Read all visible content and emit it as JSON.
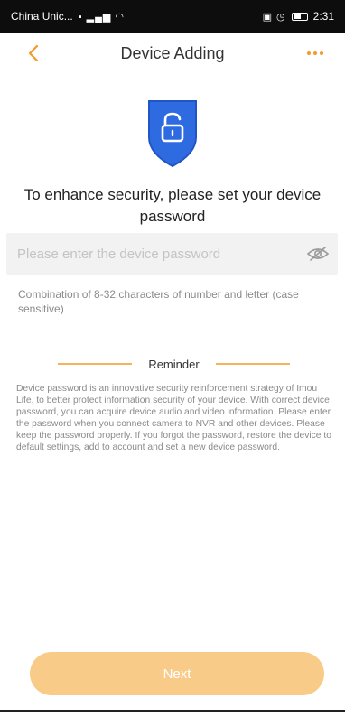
{
  "status_bar": {
    "carrier": "China Unic...",
    "time": "2:31"
  },
  "header": {
    "title": "Device Adding",
    "back_icon": "chevron-left-icon",
    "more_icon": "more-dots-icon"
  },
  "security": {
    "icon": "shield-lock-icon",
    "heading": "To enhance security, please set your device password"
  },
  "password": {
    "placeholder": "Please enter the device password",
    "value": "",
    "toggle_icon": "eye-off-icon",
    "hint": "Combination of 8-32 characters of number and letter (case sensitive)"
  },
  "reminder": {
    "label": "Reminder",
    "text": "Device password is an innovative security reinforcement strategy of Imou Life, to better protect information security of your device. With correct device password, you can acquire device audio and video information. Please enter the password when you connect camera to NVR and other devices. Please keep the password properly. If you forgot the password, restore the device to default settings, add to account and set a new device password."
  },
  "actions": {
    "next_label": "Next"
  },
  "colors": {
    "accent": "#f39a2b",
    "accent_light": "#f9cb88",
    "shield_blue": "#2f6be0"
  }
}
